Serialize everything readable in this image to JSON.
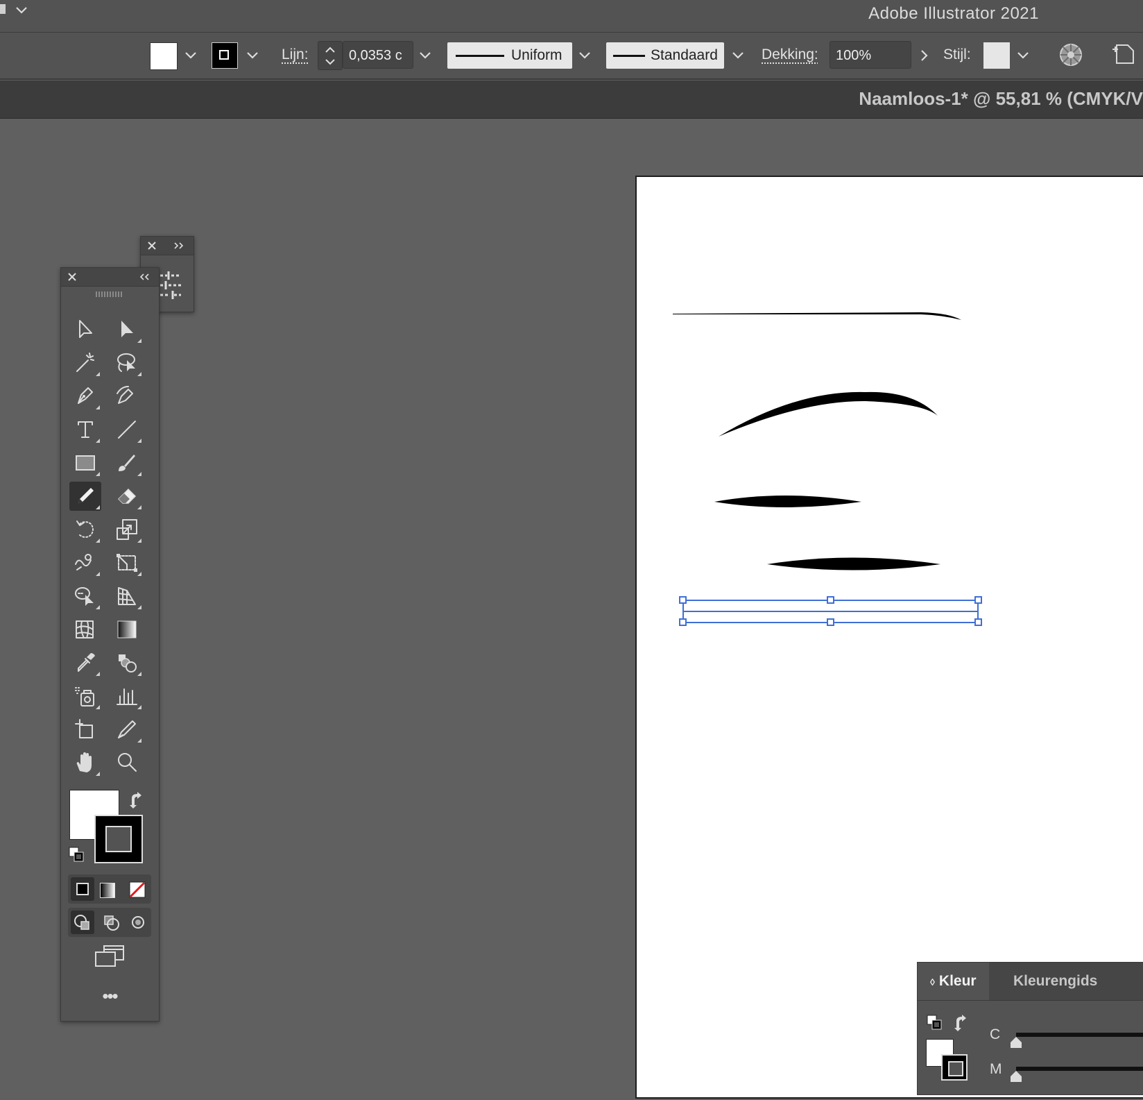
{
  "app": {
    "title": "Adobe Illustrator 2021"
  },
  "control_bar": {
    "stroke_label": "Lijn:",
    "stroke_weight": "0,0353 c",
    "variable_width": "Uniform",
    "brush_definition": "Standaard",
    "opacity_label": "Dekking:",
    "opacity_value": "100%",
    "style_label": "Stijl:"
  },
  "document": {
    "tab_title": "Naamloos-1* @ 55,81 % (CMYK/V"
  },
  "tools_panel": {
    "tools": [
      "selection-tool",
      "direct-selection-tool",
      "magic-wand-tool",
      "lasso-tool",
      "pen-tool",
      "curvature-tool",
      "type-tool",
      "line-segment-tool",
      "rectangle-tool",
      "paintbrush-tool",
      "pencil-tool",
      "eraser-tool",
      "rotate-tool",
      "scale-tool",
      "warp-tool",
      "free-transform-tool",
      "shape-builder-tool",
      "perspective-grid-tool",
      "mesh-tool",
      "gradient-tool",
      "eyedropper-tool",
      "blend-tool",
      "symbol-sprayer-tool",
      "column-graph-tool",
      "artboard-tool",
      "slice-tool",
      "hand-tool",
      "zoom-tool"
    ],
    "selected_tool": "pencil-tool",
    "more_label": "•••"
  },
  "color_panel": {
    "tabs": [
      "Kleur",
      "Kleurengids"
    ],
    "active_tab": "Kleur",
    "sliders": [
      "C",
      "M"
    ]
  },
  "colors": {
    "selection_blue": "#3f6fd6",
    "canvas_bg": "#606060",
    "ui_bg": "#535353"
  }
}
